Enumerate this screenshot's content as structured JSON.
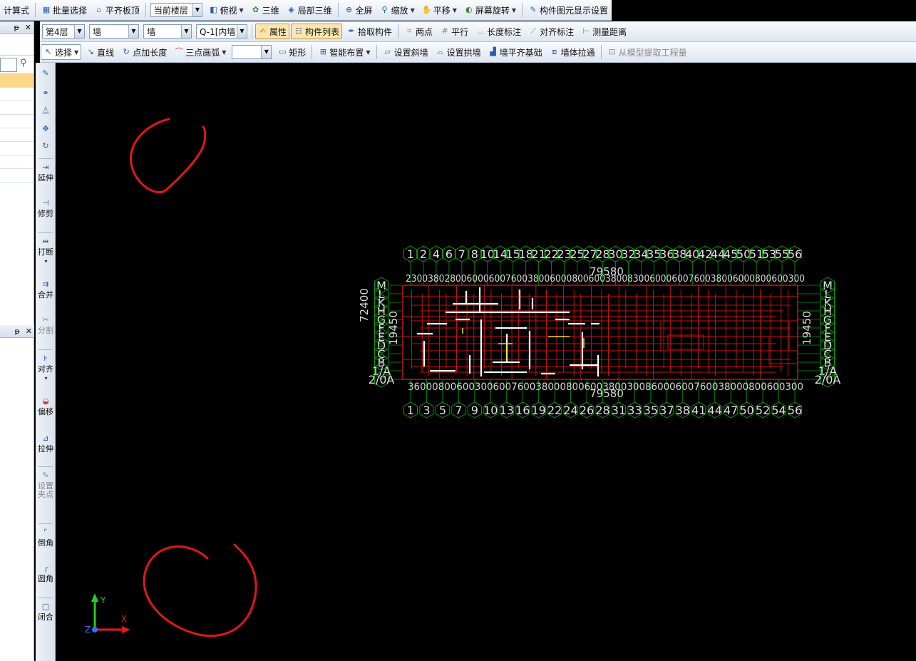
{
  "toolbar1": {
    "calc_formula": "计算式",
    "batch_select": "批量选择",
    "align_slab_top": "平齐板顶",
    "floor_scope": "当前楼层",
    "top_view": "俯视",
    "view_3d": "三维",
    "local_3d": "局部三维",
    "fullscreen": "全屏",
    "zoom": "缩放",
    "pan": "平移",
    "screen_rotate": "屏幕旋转",
    "element_display_settings": "构件图元显示设置"
  },
  "toolbar2": {
    "floor": "第4层",
    "category": "墙",
    "subtype": "墙",
    "element": "Q-1[内墙",
    "properties": "属性",
    "element_list": "构件列表",
    "pick_element": "拾取构件",
    "two_points": "两点",
    "parallel": "平行",
    "length_dim": "长度标注",
    "aligned_dim": "对齐标注",
    "measure_distance": "测量距离"
  },
  "toolbar3": {
    "select": "选择",
    "line": "直线",
    "point_length": "点加长度",
    "three_point_arc": "三点画弧",
    "rectangle": "矩形",
    "smart_layout": "智能布置",
    "set_slope_wall": "设置斜墙",
    "set_arch_wall": "设置拱墙",
    "wall_align_foundation": "墙平齐基础",
    "wall_stretch": "墙体拉通",
    "extract_quantity": "从模型提取工程量"
  },
  "panel": {
    "pin": "ᵽ",
    "close": "✕"
  },
  "vtools": [
    {
      "label": "延伸"
    },
    {
      "label": "修剪"
    },
    {
      "label": "打断"
    },
    {
      "label": "合并"
    },
    {
      "label": "分割"
    },
    {
      "label": "对齐"
    },
    {
      "label": "偏移"
    },
    {
      "label": "拉伸"
    },
    {
      "label": "设置夹点"
    },
    {
      "label": "倒角"
    },
    {
      "label": "圆角"
    },
    {
      "label": "闭合"
    }
  ],
  "drawing": {
    "top_axes": [
      "1",
      "2",
      "4",
      "6",
      "7",
      "8",
      "10",
      "14",
      "15",
      "18",
      "21",
      "22",
      "23",
      "25",
      "27",
      "28",
      "30",
      "32",
      "34",
      "35",
      "36",
      "38",
      "40",
      "42",
      "44",
      "45",
      "50",
      "51",
      "53",
      "55",
      "56"
    ],
    "bottom_axes": [
      "1",
      "3",
      "5",
      "7",
      "9",
      "10",
      "13",
      "16",
      "19",
      "22",
      "24",
      "26",
      "28",
      "31",
      "33",
      "35",
      "37",
      "38",
      "41",
      "44",
      "47",
      "50",
      "52",
      "54",
      "56"
    ],
    "left_axes": [
      "M",
      "L",
      "K",
      "H",
      "G",
      "F",
      "E",
      "D",
      "C",
      "B",
      "1/A",
      "2/0A"
    ],
    "right_axes": [
      "M",
      "L",
      "K",
      "H",
      "G",
      "F",
      "E",
      "D",
      "C",
      "B",
      "1/A",
      "2/0A"
    ],
    "total_dimension_top": "79580",
    "total_dimension_bottom": "79580",
    "side_dimension_left": "19450",
    "side_dimension_right": "19450",
    "side_dimension_left2": "72400",
    "dim_row_top": "230038028006000600760038006000800600380083006000600760038006000800600300",
    "dim_row_bottom": "36000800600300600760038000800600380030086000600760038000800600300",
    "colors": {
      "grid": "#00a000",
      "wall_red": "#c81414",
      "wall_white": "#ffffff",
      "annotation": "#e01818",
      "text": "#d8d8d8"
    }
  },
  "ucs": {
    "y": "Y",
    "x": "X",
    "z": "Z"
  }
}
